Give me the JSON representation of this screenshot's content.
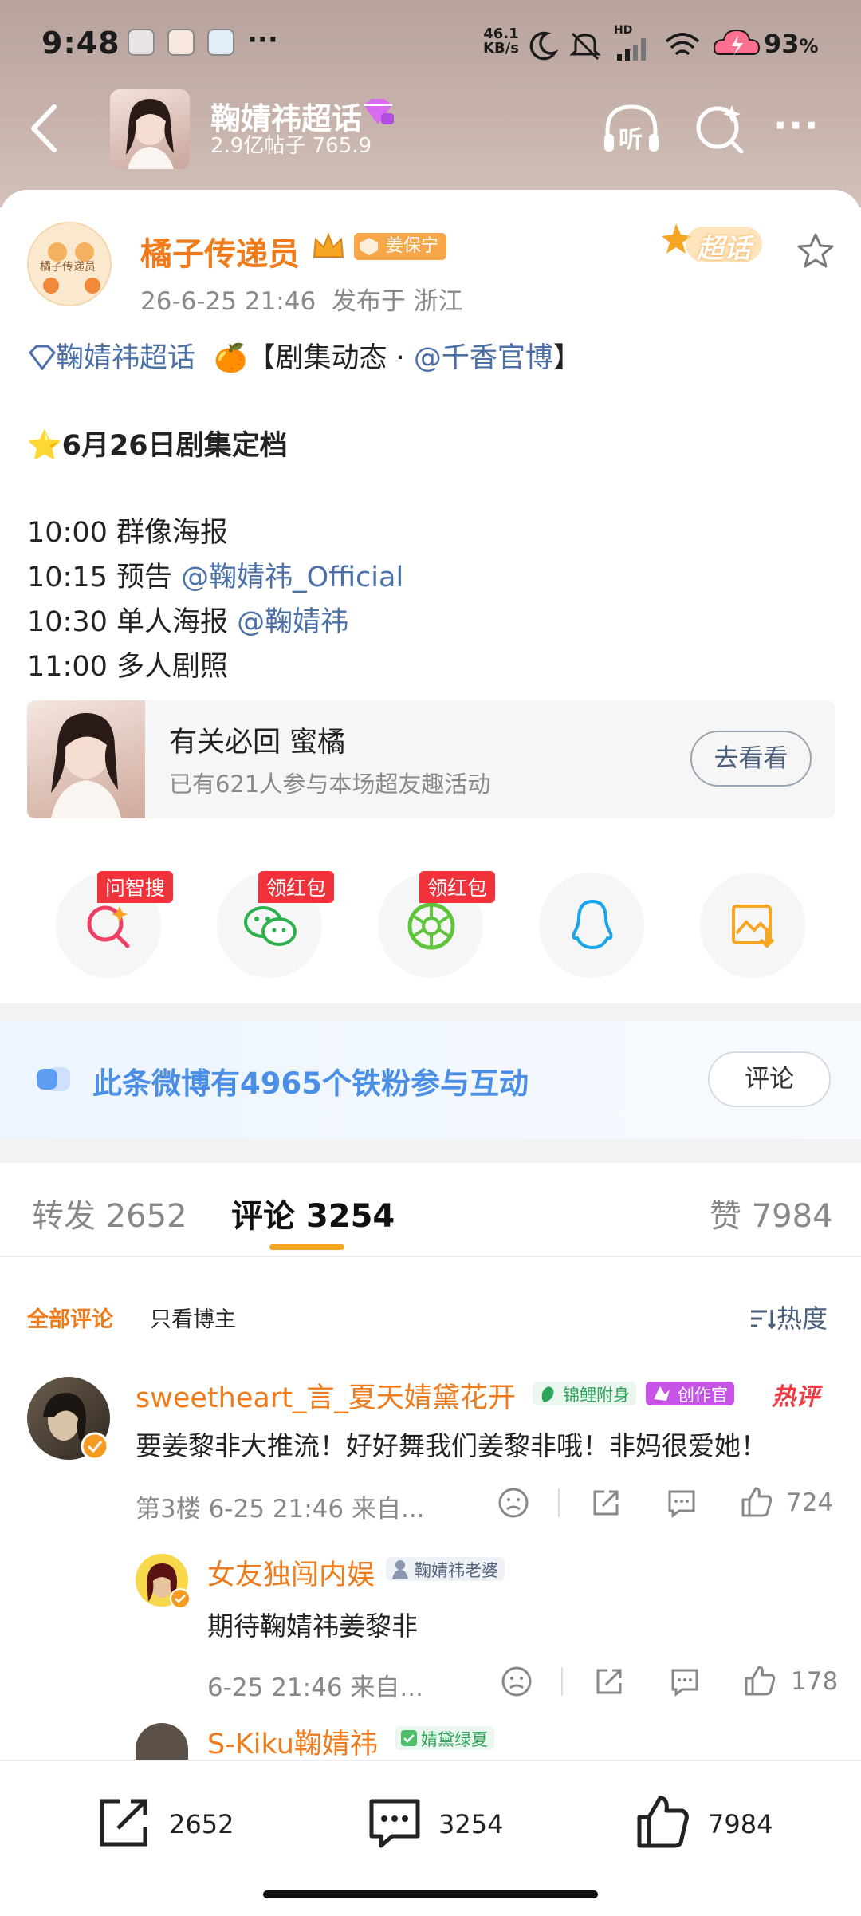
{
  "status_bar": {
    "time": "9:48",
    "net_speed_value": "46.1",
    "net_speed_unit": "KB/s",
    "battery": "93",
    "battery_unit": "%",
    "hd": "HD"
  },
  "nav": {
    "title": "鞠婧祎超话",
    "subtitle": "2.9亿帖子 765.9",
    "listen_label": "听"
  },
  "post": {
    "author": "橘子传递员",
    "avatar_text": "橘子传递员",
    "fan_badge": "姜保宁",
    "meta": "26-6-25 21:46  发布于 浙江",
    "super_topic_badge": "超话",
    "line1_topic": "鞠婧祎超话",
    "line1_rest": "【剧集动态 · ",
    "line1_link": "@千香官博",
    "line1_end": "】",
    "line2": "6月26日剧集定档",
    "schedule": [
      {
        "time": "10:00",
        "text": "群像海报",
        "link": ""
      },
      {
        "time": "10:15",
        "text": "预告",
        "link": "@鞠婧祎_Official"
      },
      {
        "time": "10:30",
        "text": "单人海报",
        "link": "@鞠婧祎"
      },
      {
        "time": "11:00",
        "text": "多人剧照",
        "link": ""
      }
    ],
    "activity": {
      "title": "有关必回 蜜橘",
      "subtitle": "已有621人参与本场超友趣活动",
      "button": "去看看"
    }
  },
  "share": {
    "items": [
      {
        "icon": "ai-search-icon",
        "badge": "问智搜"
      },
      {
        "icon": "wechat-icon",
        "badge": "领红包"
      },
      {
        "icon": "moments-icon",
        "badge": "领红包"
      },
      {
        "icon": "qq-icon",
        "badge": ""
      },
      {
        "icon": "save-image-icon",
        "badge": ""
      }
    ]
  },
  "fan_banner": {
    "text": "此条微博有4965个铁粉参与互动",
    "button": "评论"
  },
  "tabs": {
    "repost_label": "转发",
    "repost_count": "2652",
    "comment_label": "评论",
    "comment_count": "3254",
    "like_label": "赞",
    "like_count": "7984"
  },
  "filter": {
    "all": "全部评论",
    "author_only": "只看博主",
    "sort": "热度"
  },
  "comments": [
    {
      "name": "sweetheart_言_夏天婧黛花开",
      "tag1": "锦鲤附身",
      "tag2": "创作官",
      "hot": "热评",
      "text": "要姜黎非大推流！好好舞我们姜黎非哦！非妈很爱她！",
      "meta": "第3楼 6-25 21:46 来自...",
      "likes": "724"
    },
    {
      "name": "女友独闯内娱",
      "tag1": "鞠婧祎老婆",
      "text": "期待鞠婧祎姜黎非",
      "meta": "6-25 21:46 来自...",
      "likes": "178"
    },
    {
      "name": "S-Kiku鞠婧祎",
      "tag1": "婧黛绿夏"
    }
  ],
  "bottom_bar": {
    "repost": "2652",
    "comment": "3254",
    "like": "7984"
  },
  "colors": {
    "accent": "#f07b1b",
    "link": "#4b70a8",
    "badge_red": "#f1323a",
    "tab_underline": "#f5a623"
  }
}
